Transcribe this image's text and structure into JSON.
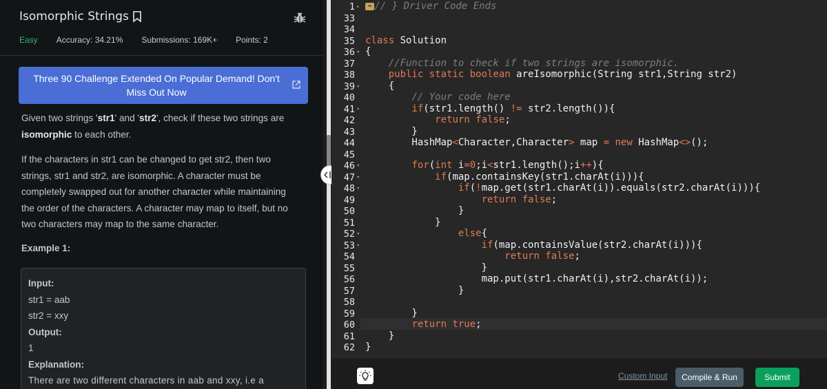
{
  "problem": {
    "title": "Isomorphic Strings",
    "difficulty": "Easy",
    "accuracy": "Accuracy: 34.21%",
    "submissions": "Submissions: 169K+",
    "points": "Points: 2",
    "banner_line1": "Three 90 Challenge Extended On Popular Demand! Don't",
    "banner_line2": "Miss Out Now",
    "desc1_a": "Given two strings '",
    "desc1_b": "str1",
    "desc1_c": "' and '",
    "desc1_d": "str2",
    "desc1_e": "', check if these two strings are",
    "desc1_f": "isomorphic",
    "desc1_g": " to each other.",
    "desc2": [
      "If the characters in str1 can be changed to get str2, then two",
      "strings, str1 and str2, are isomorphic. A character must be",
      "completely swapped out for another character while maintaining",
      "the order of the characters. A character may map to itself, but no",
      "two characters may map to the same character."
    ],
    "example_label": "Example 1:",
    "example": {
      "input_label": "Input:",
      "input1": "str1  =  aab",
      "input2": "str2  =  xxy",
      "output_label": "Output:",
      "output": "1",
      "explanation_label": "Explanation:",
      "explanation": "There are two different characters in aab and xxy, i.e a"
    }
  },
  "editor": {
    "line_numbers": [
      "1",
      "33",
      "34",
      "35",
      "36",
      "37",
      "38",
      "39",
      "40",
      "41",
      "42",
      "43",
      "44",
      "45",
      "46",
      "47",
      "48",
      "49",
      "50",
      "51",
      "52",
      "53",
      "54",
      "55",
      "56",
      "57",
      "58",
      "59",
      "60",
      "61",
      "62"
    ],
    "fold_marker": "↔",
    "first_line_comment": "// } Driver Code Ends",
    "current_line": "60"
  },
  "toolbar": {
    "custom_input": "Custom Input",
    "compile_run": "Compile & Run",
    "submit": "Submit"
  },
  "colors": {
    "accent_green": "#0aa05c",
    "banner_blue": "#4a6ed6",
    "easy_green": "#2eb872",
    "keyword": "#e07b53"
  }
}
